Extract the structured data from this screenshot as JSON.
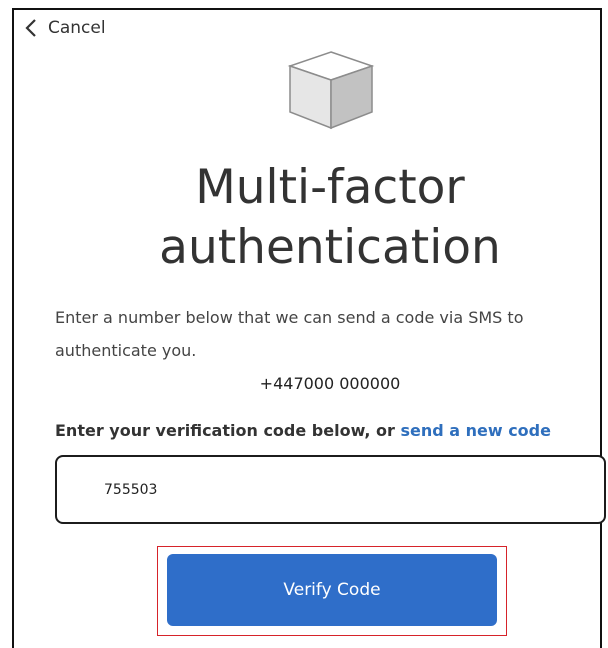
{
  "nav": {
    "cancel_label": "Cancel"
  },
  "header": {
    "logo_icon": "cube-icon",
    "title": "Multi-factor authentication"
  },
  "main": {
    "description": "Enter a number below that we can send a code via SMS to authenticate you.",
    "phone_number": "+447000 000000",
    "code_prompt": "Enter your verification code below, or",
    "resend_link": "send a new code",
    "code_input": {
      "value": "755503"
    },
    "verify_label": "Verify Code"
  },
  "colors": {
    "accent": "#2f6ec9",
    "link": "#2f6fbd",
    "highlight": "#d6232a"
  }
}
